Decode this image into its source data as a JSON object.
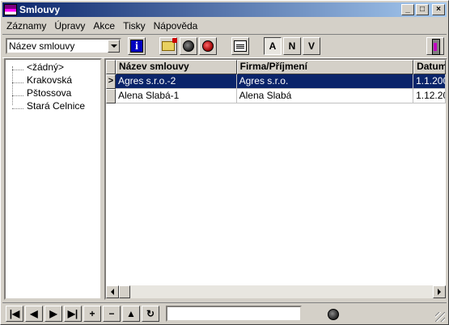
{
  "window": {
    "title": "Smlouvy"
  },
  "title_buttons": {
    "minimize": "_",
    "maximize": "□",
    "close": "×"
  },
  "menu": [
    "Záznamy",
    "Úpravy",
    "Akce",
    "Tisky",
    "Nápověda"
  ],
  "toolbar": {
    "field_select": "Název smlouvy",
    "info_label": "i",
    "filter_a": "A",
    "filter_n": "N",
    "filter_v": "V"
  },
  "tree": {
    "items": [
      "<žádný>",
      "Krakovská",
      "Pštossova",
      "Stará Celnice"
    ]
  },
  "grid": {
    "columns": [
      "Název smlouvy",
      "Firma/Příjmení",
      "Datum"
    ],
    "rows": [
      {
        "name": "Agres s.r.o.-2",
        "company": "Agres s.r.o.",
        "date": "1.1.200",
        "indicator": ">"
      },
      {
        "name": "Alena Slabá-1",
        "company": "Alena Slabá",
        "date": "1.12.20",
        "indicator": ""
      }
    ]
  },
  "nav": {
    "first": "|◀",
    "prev": "◀",
    "next": "▶",
    "last": "▶|",
    "add": "+",
    "delete": "−",
    "up": "▲",
    "refresh": "↻"
  },
  "status": {
    "input_value": ""
  }
}
